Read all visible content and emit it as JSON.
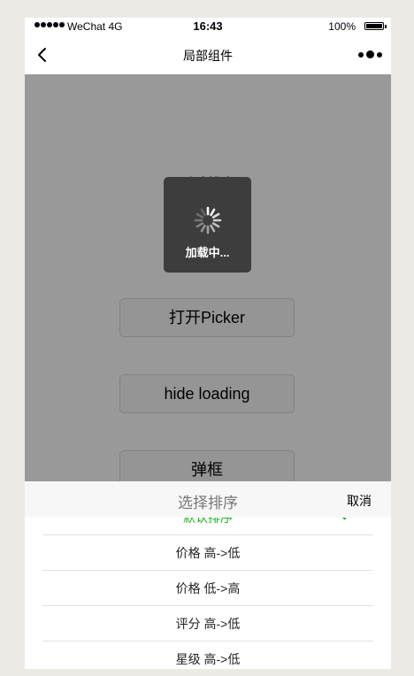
{
  "status_bar": {
    "carrier": "WeChat 4G",
    "time": "16:43",
    "battery": "100%"
  },
  "nav": {
    "title": "局部组件"
  },
  "page": {
    "sort_label": "默认排序",
    "buttons": {
      "picker": "打开Picker",
      "hide_loading": "hide loading",
      "dialog": "弹框"
    }
  },
  "toast": {
    "text": "加载中..."
  },
  "action_sheet": {
    "title": "选择排序",
    "cancel": "取消",
    "options": [
      {
        "label": "默认排序",
        "selected": true
      },
      {
        "label": "价格 高->低",
        "selected": false
      },
      {
        "label": "价格 低->高",
        "selected": false
      },
      {
        "label": "评分 高->低",
        "selected": false
      },
      {
        "label": "星级 高->低",
        "selected": false
      }
    ]
  },
  "colors": {
    "accent": "#1aad19",
    "toast_bg": "#3d3d3d",
    "sheet_header_bg": "#f7f7f7"
  }
}
